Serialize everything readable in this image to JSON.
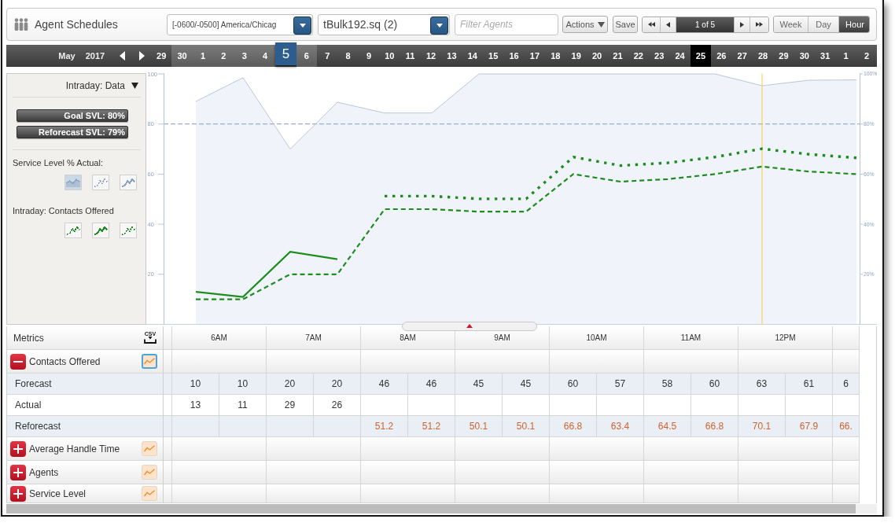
{
  "header": {
    "title": "Agent Schedules",
    "timezone_select": {
      "value": "[-0600/-0500] America/Chicag"
    },
    "schedule_select": {
      "value": "tBulk192.sq (2)"
    },
    "filter": {
      "placeholder": "Filter Agents"
    },
    "actions_button": "Actions",
    "save_button": "Save",
    "pager": {
      "label": "1 of 5"
    },
    "view_tabs": [
      {
        "label": "Week",
        "selected": false
      },
      {
        "label": "Day",
        "selected": false
      },
      {
        "label": "Hour",
        "selected": true
      }
    ]
  },
  "date_strip": {
    "month": "May",
    "year": "2017",
    "dates": [
      {
        "label": "29",
        "selected": false,
        "in_week": false,
        "today": false
      },
      {
        "label": "30",
        "selected": false,
        "in_week": true,
        "today": false
      },
      {
        "label": "1",
        "selected": false,
        "in_week": true,
        "today": false
      },
      {
        "label": "2",
        "selected": false,
        "in_week": true,
        "today": false
      },
      {
        "label": "3",
        "selected": false,
        "in_week": true,
        "today": false
      },
      {
        "label": "4",
        "selected": false,
        "in_week": true,
        "today": false
      },
      {
        "label": "5",
        "selected": true,
        "in_week": true,
        "today": false
      },
      {
        "label": "6",
        "selected": false,
        "in_week": true,
        "today": false
      },
      {
        "label": "7",
        "selected": false,
        "in_week": false,
        "today": false
      },
      {
        "label": "8",
        "selected": false,
        "in_week": false,
        "today": false
      },
      {
        "label": "9",
        "selected": false,
        "in_week": false,
        "today": false
      },
      {
        "label": "10",
        "selected": false,
        "in_week": false,
        "today": false
      },
      {
        "label": "11",
        "selected": false,
        "in_week": false,
        "today": false
      },
      {
        "label": "12",
        "selected": false,
        "in_week": false,
        "today": false
      },
      {
        "label": "13",
        "selected": false,
        "in_week": false,
        "today": false
      },
      {
        "label": "14",
        "selected": false,
        "in_week": false,
        "today": false
      },
      {
        "label": "15",
        "selected": false,
        "in_week": false,
        "today": false
      },
      {
        "label": "16",
        "selected": false,
        "in_week": false,
        "today": false
      },
      {
        "label": "17",
        "selected": false,
        "in_week": false,
        "today": false
      },
      {
        "label": "18",
        "selected": false,
        "in_week": false,
        "today": false
      },
      {
        "label": "19",
        "selected": false,
        "in_week": false,
        "today": false
      },
      {
        "label": "20",
        "selected": false,
        "in_week": false,
        "today": false
      },
      {
        "label": "21",
        "selected": false,
        "in_week": false,
        "today": false
      },
      {
        "label": "22",
        "selected": false,
        "in_week": false,
        "today": false
      },
      {
        "label": "23",
        "selected": false,
        "in_week": false,
        "today": false
      },
      {
        "label": "24",
        "selected": false,
        "in_week": false,
        "today": false
      },
      {
        "label": "25",
        "selected": false,
        "in_week": false,
        "today": true
      },
      {
        "label": "26",
        "selected": false,
        "in_week": false,
        "today": false
      },
      {
        "label": "27",
        "selected": false,
        "in_week": false,
        "today": false
      },
      {
        "label": "28",
        "selected": false,
        "in_week": false,
        "today": false
      },
      {
        "label": "29",
        "selected": false,
        "in_week": false,
        "today": false
      },
      {
        "label": "30",
        "selected": false,
        "in_week": false,
        "today": false
      },
      {
        "label": "31",
        "selected": false,
        "in_week": false,
        "today": false
      },
      {
        "label": "1",
        "selected": false,
        "in_week": false,
        "today": false
      },
      {
        "label": "2",
        "selected": false,
        "in_week": false,
        "today": false
      }
    ]
  },
  "side_panel": {
    "view_dropdown": "Intraday: Data",
    "summary_bars": [
      "Goal SVL: 80%",
      "Reforecast SVL: 79%"
    ],
    "sections": [
      {
        "label": "Service Level % Actual:",
        "color": "#8ba3be",
        "styles": [
          {
            "kind": "area",
            "selected": true
          },
          {
            "kind": "dotted",
            "selected": false
          },
          {
            "kind": "solid",
            "selected": false
          }
        ]
      },
      {
        "label": "Intraday: Contacts Offered",
        "color": "#1e8c1e",
        "styles": [
          {
            "kind": "dashed",
            "selected": false
          },
          {
            "kind": "solid",
            "selected": false
          },
          {
            "kind": "dotted",
            "selected": false
          }
        ]
      }
    ]
  },
  "chart": {
    "chart_data": {
      "type": "line",
      "categories": [
        null,
        null,
        null,
        null,
        null,
        null,
        null,
        null,
        null,
        null,
        null,
        null,
        null,
        null,
        null
      ],
      "ylim": [
        0,
        100
      ],
      "yticks": [
        20,
        40,
        60,
        80,
        100
      ],
      "series": [
        {
          "color": "#b7c7da",
          "line_style": "solid",
          "values": [
            89,
            98.5,
            70,
            88.7,
            84.4,
            84.4,
            100,
            100,
            100,
            100,
            100,
            100,
            95.3,
            97.5,
            97.6
          ]
        },
        {
          "color": "#1e8c1e",
          "line_style": "dashed",
          "values": [
            10,
            10,
            20,
            20,
            46,
            46,
            45,
            45,
            60,
            57,
            58,
            60,
            63,
            61,
            60
          ]
        },
        {
          "color": "#1e8c1e",
          "line_style": "solid",
          "values": [
            13,
            11,
            29,
            26,
            null,
            null,
            null,
            null,
            null,
            null,
            null,
            null,
            null,
            null,
            null
          ]
        },
        {
          "color": "#1e8c1e",
          "line_style": "dotted",
          "values": [
            null,
            null,
            null,
            null,
            51.2,
            51.2,
            50.1,
            50.1,
            66.8,
            63.4,
            64.5,
            66.8,
            70.1,
            67.9,
            66.5
          ]
        }
      ],
      "ref_lines": [
        {
          "axis": "y",
          "value": 80
        }
      ]
    },
    "percent_axis_labels": [
      "100%",
      "80%",
      "60%",
      "40%",
      "20%"
    ]
  },
  "metrics_table": {
    "header": "Metrics",
    "export_label": "CSV",
    "hours": [
      "6AM",
      "7AM",
      "8AM",
      "9AM",
      "10AM",
      "11AM",
      "12PM"
    ],
    "groups": [
      {
        "label": "Contacts Offered",
        "expanded": true,
        "charted": true,
        "rows": [
          {
            "label": "Forecast",
            "kind": "forecast"
          },
          {
            "label": "Actual",
            "kind": "actual"
          },
          {
            "label": "Reforecast",
            "kind": "reforecast"
          }
        ],
        "columns": [
          {
            "forecast": "10",
            "actual": "13"
          },
          {
            "forecast": "10",
            "actual": "11"
          },
          {
            "forecast": "20",
            "actual": "29"
          },
          {
            "forecast": "20",
            "actual": "26"
          },
          {
            "forecast": "46",
            "reforecast": "51.2"
          },
          {
            "forecast": "46",
            "reforecast": "51.2"
          },
          {
            "forecast": "45",
            "reforecast": "50.1"
          },
          {
            "forecast": "45",
            "reforecast": "50.1"
          },
          {
            "forecast": "60",
            "reforecast": "66.8"
          },
          {
            "forecast": "57",
            "reforecast": "63.4"
          },
          {
            "forecast": "58",
            "reforecast": "64.5"
          },
          {
            "forecast": "60",
            "reforecast": "66.8"
          },
          {
            "forecast": "63",
            "reforecast": "70.1"
          },
          {
            "forecast": "61",
            "reforecast": "67.9"
          },
          {
            "forecast": "6",
            "reforecast": "66."
          }
        ]
      },
      {
        "label": "Average Handle Time",
        "expanded": false,
        "charted": false
      },
      {
        "label": "Agents",
        "expanded": false,
        "charted": false
      },
      {
        "label": "Service Level",
        "expanded": false,
        "charted": false
      }
    ]
  }
}
